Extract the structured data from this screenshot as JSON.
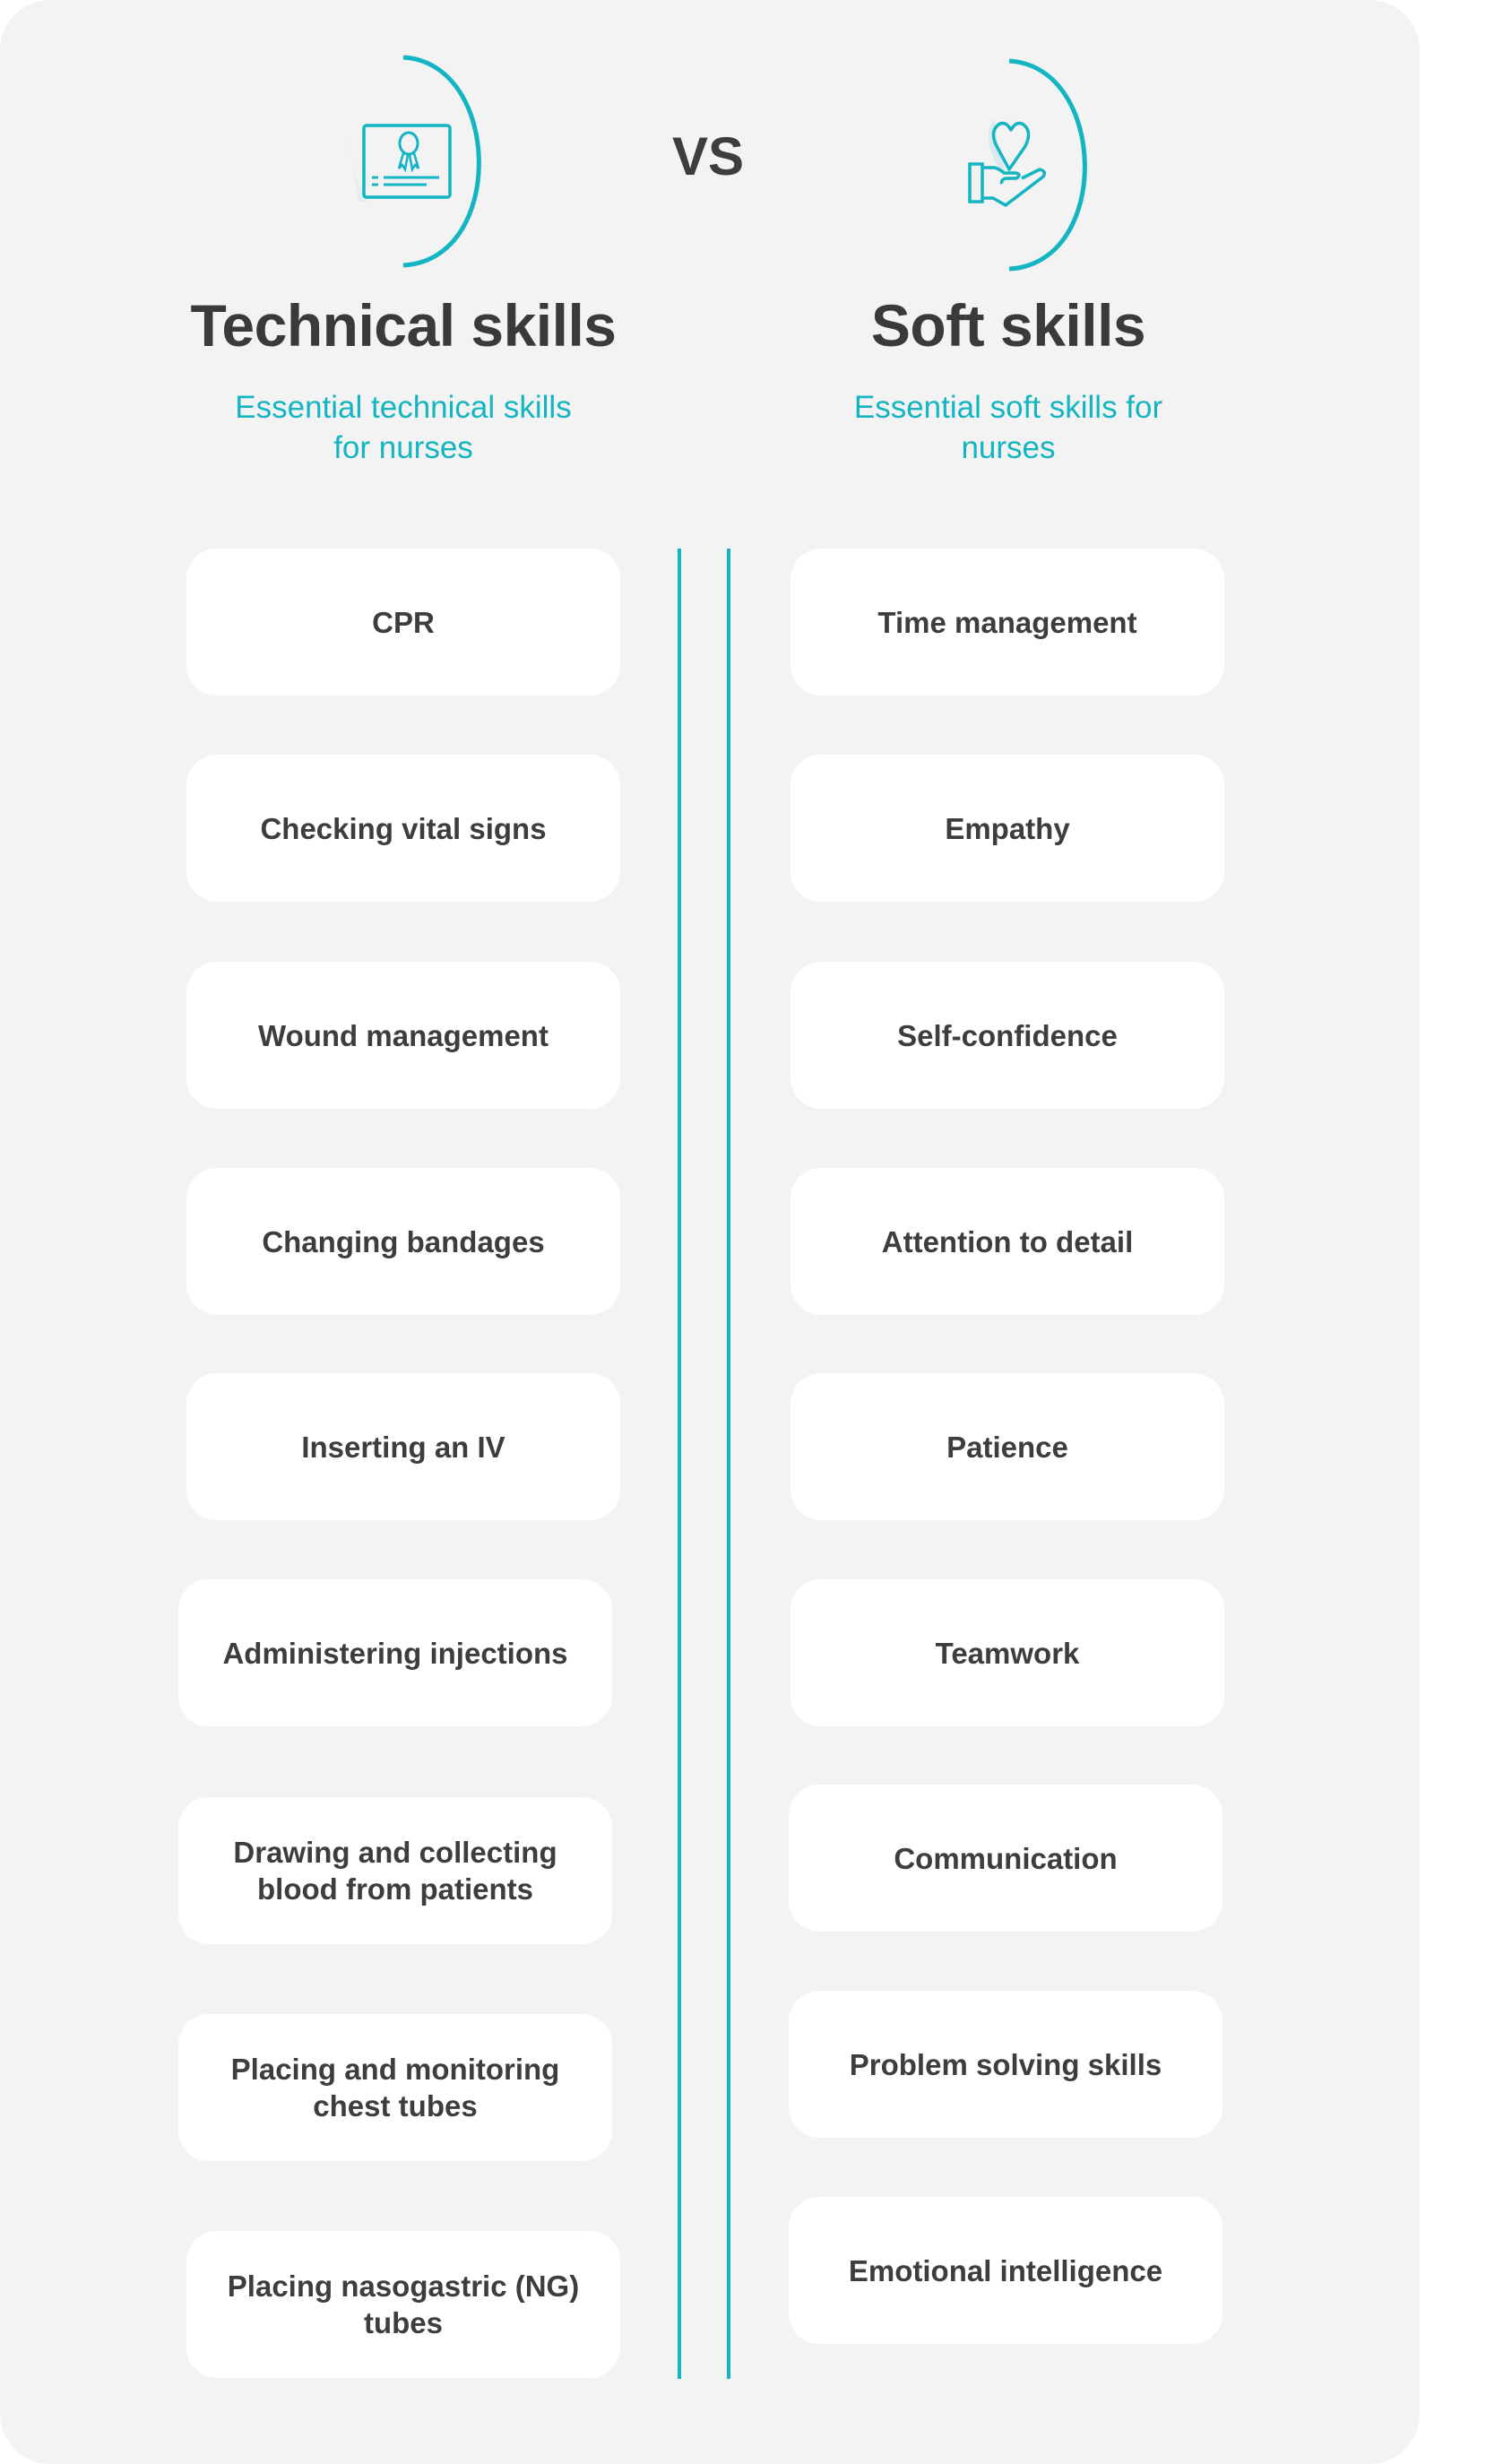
{
  "header": {
    "vs_label": "VS"
  },
  "colors": {
    "accent": "#12b5c1",
    "text": "#3d3d3d",
    "card_background": "#f3f3f3",
    "box_background": "#ffffff"
  },
  "technical": {
    "icon": "certificate-icon",
    "title": "Technical skills",
    "subtitle_line1": "Essential technical skills",
    "subtitle_line2": "for nurses",
    "items": [
      "CPR",
      "Checking vital signs",
      "Wound management",
      "Changing bandages",
      "Inserting an IV",
      "Administering injections",
      "Drawing and collecting blood from patients",
      "Placing and monitoring chest tubes",
      "Placing nasogastric (NG) tubes"
    ]
  },
  "soft": {
    "icon": "heart-in-hand-icon",
    "title": "Soft skills",
    "subtitle_line1": "Essential soft skills for",
    "subtitle_line2": "nurses",
    "items": [
      "Time management",
      "Empathy",
      "Self-confidence",
      "Attention to detail",
      "Patience",
      "Teamwork",
      "Communication",
      "Problem solving skills",
      "Emotional intelligence"
    ]
  }
}
